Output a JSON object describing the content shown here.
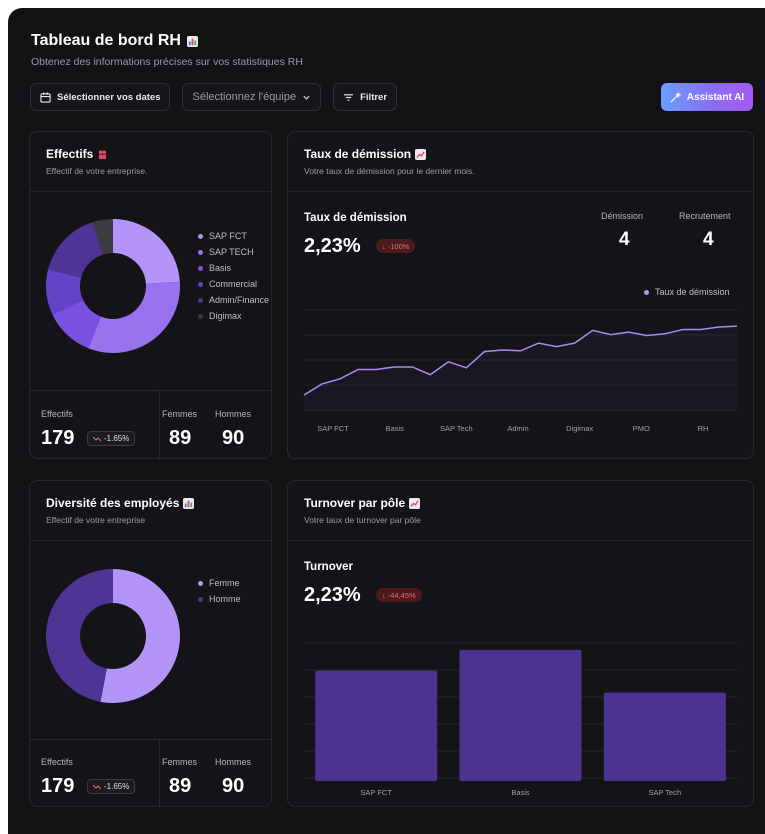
{
  "header": {
    "title": "Tableau de bord RH",
    "subtitle": "Obtenez des informations précises sur vos statistiques RH"
  },
  "toolbar": {
    "dates_label": "Sélectionner vos dates",
    "team_placeholder": "Sélectionnez l'équipe",
    "filter_label": "Filtrer",
    "ai_label": "Assistant AI"
  },
  "effectifs": {
    "title": "Effectifs",
    "subtitle": "Effectif de votre entreprise.",
    "legend": [
      "SAP FCT",
      "SAP TECH",
      "Basis",
      "Commercial",
      "Admin/Finance",
      "Digimax"
    ],
    "slices": [
      {
        "label": "SAP FCT",
        "value": 24,
        "color": "#b395f7"
      },
      {
        "label": "SAP TECH",
        "value": 32,
        "color": "#9a72f0"
      },
      {
        "label": "Basis",
        "value": 12,
        "color": "#7a50e0"
      },
      {
        "label": "Commercial",
        "value": 11,
        "color": "#6443c9"
      },
      {
        "label": "Admin/Finance",
        "value": 16,
        "color": "#4e3595"
      },
      {
        "label": "Digimax",
        "value": 5,
        "color": "#3b3b44"
      }
    ],
    "stats": {
      "effectifs_label": "Effectifs",
      "effectifs_value": "179",
      "change": "-1.65%",
      "femmes_label": "Femmes",
      "femmes_value": "89",
      "hommes_label": "Hommes",
      "hommes_value": "90"
    }
  },
  "demission": {
    "title": "Taux de démission",
    "subtitle": "Votre taux de démission pour le dernier mois.",
    "metric_title": "Taux de démission",
    "metric_value": "2,23%",
    "metric_change": "-100%",
    "demission_label": "Démission",
    "demission_value": "4",
    "recrutement_label": "Recrutement",
    "recrutement_value": "4",
    "legend": "Taux de démission"
  },
  "diversite": {
    "title": "Diversité des employés",
    "subtitle": "Effectif de votre entreprise",
    "legend": [
      "Femme",
      "Homme"
    ],
    "slices": [
      {
        "label": "Femme",
        "value": 53,
        "color": "#b395f7"
      },
      {
        "label": "Homme",
        "value": 47,
        "color": "#4e3595"
      }
    ],
    "stats": {
      "effectifs_label": "Effectifs",
      "effectifs_value": "179",
      "change": "-1.65%",
      "femmes_label": "Femmes",
      "femmes_value": "89",
      "hommes_label": "Hommes",
      "hommes_value": "90"
    }
  },
  "turnover": {
    "title": "Turnover par pôle",
    "subtitle": "Votre taux de turnover par pôle",
    "metric_title": "Turnover",
    "metric_value": "2,23%",
    "metric_change": "-44,45%"
  },
  "chart_data": [
    {
      "type": "line",
      "series": [
        {
          "name": "Taux de démission",
          "values": [
            2.0,
            3.3,
            3.9,
            5.0,
            5.0,
            5.3,
            5.3,
            4.4,
            5.9,
            5.2,
            7.1,
            7.3,
            7.2,
            8.1,
            7.7,
            8.1,
            9.6,
            9.1,
            9.4,
            9.0,
            9.2,
            9.7,
            9.7,
            10.0,
            10.1
          ]
        }
      ],
      "categories": [
        "SAP FCT",
        "Basis",
        "SAP Tech",
        "Admin",
        "Digimax",
        "PMO",
        "RH"
      ],
      "ylim": [
        0,
        12
      ],
      "grid": true,
      "legend": "top-right"
    },
    {
      "type": "bar",
      "categories": [
        "SAP FCT",
        "Basis",
        "SAP Tech"
      ],
      "values": [
        80,
        95,
        64
      ],
      "ylim": [
        0,
        100
      ],
      "grid": true
    }
  ],
  "colors": {
    "accent": "#8b6cf5",
    "bar": "#4b3490",
    "line": "#a98af5",
    "negative": "#f26b6b"
  }
}
